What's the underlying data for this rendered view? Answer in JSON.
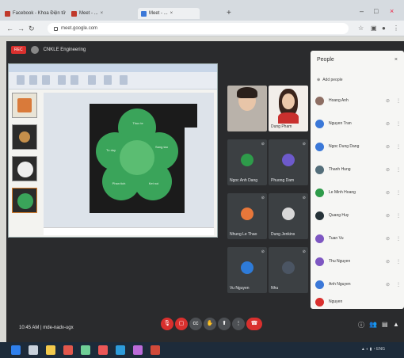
{
  "browser": {
    "tabs": [
      {
        "label": "Facebook - Khoa Điện tử"
      },
      {
        "label": "Meet - ..."
      },
      {
        "label": "Meet - ..."
      }
    ],
    "new_tab": "+",
    "url": "meet.google.com"
  },
  "meet": {
    "recording_badge": "REC",
    "meeting_name": "CNKLE Engineering",
    "time_text": "10:45 AM",
    "meeting_code": "mde-nadv-ugx"
  },
  "tiles": [
    {
      "name": "",
      "kind": "video"
    },
    {
      "name": "Dung Pham",
      "kind": "video"
    },
    {
      "name": "Ngoc Anh Dang",
      "kind": "avatar",
      "color": "#2e9b4a"
    },
    {
      "name": "Phuong Dam",
      "kind": "avatar",
      "color": "#6d5acb"
    },
    {
      "name": "Nhung Le Thao",
      "kind": "avatar",
      "color": "#e8773a"
    },
    {
      "name": "Dung Jenkins",
      "kind": "avatar",
      "color": "#888"
    },
    {
      "name": "Vu Nguyen",
      "kind": "avatar",
      "color": "#2e7bd8"
    },
    {
      "name": "Nhu",
      "kind": "avatar",
      "color": "#4b5563"
    }
  ],
  "people": {
    "title": "People",
    "add_label": "Add people",
    "rows": [
      {
        "name": "Hoang Anh",
        "color": "#8d6e63"
      },
      {
        "name": "Nguyen Tran",
        "color": "#3b78d8"
      },
      {
        "name": "Ngoc Dung Dang",
        "color": "#3b78d8"
      },
      {
        "name": "Thanh Hung",
        "color": "#546e7a"
      },
      {
        "name": "Le Minh Hoang",
        "color": "#2e9b4a"
      },
      {
        "name": "Quang Huy",
        "color": "#263238"
      },
      {
        "name": "Tuan Vu",
        "color": "#7e57c2"
      },
      {
        "name": "Thu Nguyen",
        "color": "#7e57c2"
      },
      {
        "name": "Anh Nguyen",
        "color": "#3b78d8"
      },
      {
        "name": "Nguyen",
        "color": "#d9302e"
      }
    ]
  },
  "slide": {
    "petal_color": "#3aa45a",
    "labels": [
      "Thuc te",
      "Tu duy",
      "Sang tao",
      "Phan tich",
      "Ket noi"
    ]
  }
}
